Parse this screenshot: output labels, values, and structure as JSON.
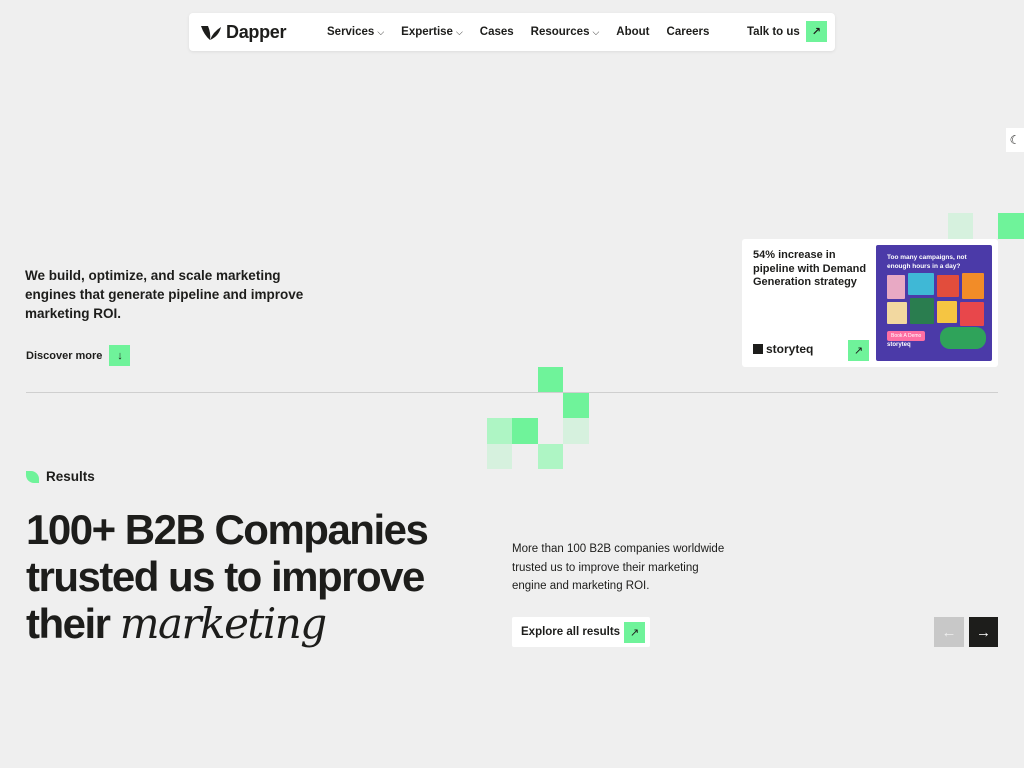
{
  "brand": {
    "name": "Dapper"
  },
  "nav": {
    "items": [
      {
        "label": "Services",
        "dropdown": true
      },
      {
        "label": "Expertise",
        "dropdown": true
      },
      {
        "label": "Cases",
        "dropdown": false
      },
      {
        "label": "Resources",
        "dropdown": true
      },
      {
        "label": "About",
        "dropdown": false
      },
      {
        "label": "Careers",
        "dropdown": false
      }
    ],
    "cta_label": "Talk to us",
    "chevron_glyph": "⌵",
    "arrow_glyph": "↗"
  },
  "theme_toggle": {
    "icon": "moon-icon",
    "glyph": "☾"
  },
  "hero": {
    "text": "We build, optimize, and scale marketing engines that generate pipeline and improve marketing ROI.",
    "discover_label": "Discover more",
    "discover_glyph": "↓"
  },
  "case_card": {
    "text": "54% increase in pipeline with Demand Generation strategy",
    "logo_text": "storyteq",
    "image": {
      "headline": "Too many campaigns, not enough hours in a day?",
      "button": "Book A Demo",
      "brand": "storyteq"
    }
  },
  "results": {
    "section_label": "Results",
    "headline_plain": "100+ B2B Companies trusted us to improve their",
    "headline_italic": "marketing",
    "description": "More than 100 B2B companies worldwide trusted us to improve their marketing engine and marketing ROI.",
    "explore_label": "Explore all results",
    "prev_glyph": "←",
    "next_glyph": "→"
  },
  "colors": {
    "accent": "#6ff39a",
    "accent_light": "#aef5c4",
    "background": "#efefef",
    "text": "#1d1d1b",
    "case_image_bg": "#4b3aa8"
  }
}
